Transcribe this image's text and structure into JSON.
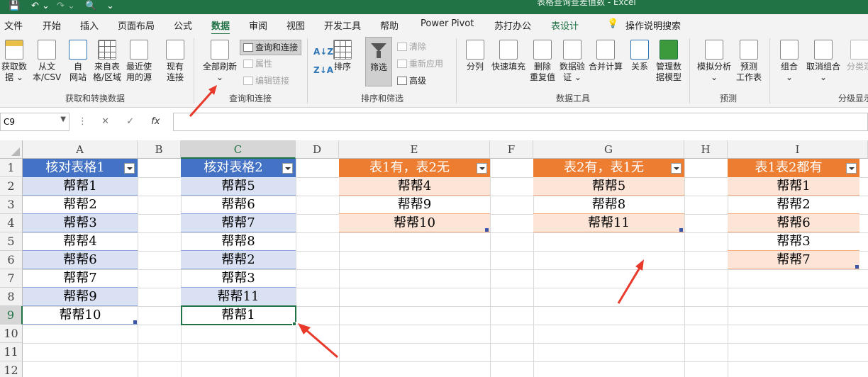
{
  "app": {
    "title": "表格查询查差值数 - Excel",
    "quick_access": [
      "save-icon",
      "undo-icon",
      "redo-icon",
      "print-preview-icon"
    ]
  },
  "menu": {
    "tabs": [
      "文件",
      "开始",
      "插入",
      "页面布局",
      "公式",
      "数据",
      "审阅",
      "视图",
      "开发工具",
      "帮助",
      "Power Pivot",
      "苏打办公",
      "表设计",
      "操作说明搜索"
    ],
    "active": "数据"
  },
  "ribbon": {
    "get_transform": {
      "label": "获取和转换数据",
      "buttons": [
        "获取数\n据 ⌄",
        "从文\n本/CSV",
        "自\n网站",
        "来自表\n格/区域",
        "最近使\n用的源",
        "现有\n连接"
      ]
    },
    "queries": {
      "label": "查询和连接",
      "refresh_all": "全部刷新\n⌄",
      "queries_connections": "查询和连接",
      "properties": "属性",
      "edit_links": "编辑链接"
    },
    "sort_filter": {
      "label": "排序和筛选",
      "sort": "排序",
      "filter": "筛选",
      "clear": "清除",
      "reapply": "重新应用",
      "advanced": "高级"
    },
    "data_tools": {
      "label": "数据工具",
      "buttons": [
        "分列",
        "快速填充",
        "删除\n重复值",
        "数据验\n证 ⌄",
        "合并计算",
        "关系",
        "管理数\n据模型"
      ]
    },
    "forecast": {
      "label": "预测",
      "buttons": [
        "模拟分析\n⌄",
        "预测\n工作表"
      ]
    },
    "outline": {
      "label": "分级显示",
      "buttons": [
        "组合\n⌄",
        "取消组合\n⌄",
        "分类汇"
      ]
    }
  },
  "formula_bar": {
    "name_box": "C9",
    "formula": ""
  },
  "sheet": {
    "columns": [
      "A",
      "B",
      "C",
      "D",
      "E",
      "F",
      "G",
      "H",
      "I"
    ],
    "rows": [
      "1",
      "2",
      "3",
      "4",
      "5",
      "6",
      "7",
      "8",
      "9",
      "10",
      "11",
      "12"
    ],
    "selected_cell": "C9",
    "table1": {
      "header": "核对表格1",
      "values": [
        "帮帮1",
        "帮帮2",
        "帮帮3",
        "帮帮4",
        "帮帮6",
        "帮帮7",
        "帮帮9",
        "帮帮10"
      ]
    },
    "table2": {
      "header": "核对表格2",
      "values": [
        "帮帮5",
        "帮帮6",
        "帮帮7",
        "帮帮8",
        "帮帮2",
        "帮帮3",
        "帮帮11",
        "帮帮1"
      ]
    },
    "table3": {
      "header": "表1有，表2无",
      "values": [
        "帮帮4",
        "帮帮9",
        "帮帮10"
      ]
    },
    "table4": {
      "header": "表2有，表1无",
      "values": [
        "帮帮5",
        "帮帮8",
        "帮帮11"
      ]
    },
    "table5": {
      "header": "表1表2都有",
      "values": [
        "帮帮1",
        "帮帮2",
        "帮帮6",
        "帮帮3",
        "帮帮7"
      ]
    }
  },
  "colors": {
    "excel_green": "#217346",
    "table_blue_header": "#4472c4",
    "table_blue_band": "#d9e1f2",
    "table_orange_header": "#ed7d31",
    "table_orange_band": "#fce4d6",
    "annotation_arrow": "#e8392b"
  }
}
